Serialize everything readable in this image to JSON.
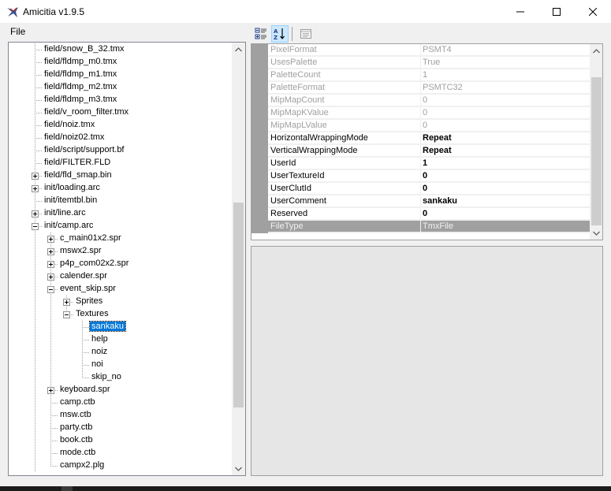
{
  "window": {
    "title": "Amicitia v1.9.5"
  },
  "menu": {
    "file": "File"
  },
  "tree": {
    "items": [
      {
        "label": "field/snow_B_32.tmx",
        "level": 0,
        "expander": "none"
      },
      {
        "label": "field/fldmp_m0.tmx",
        "level": 0,
        "expander": "none"
      },
      {
        "label": "field/fldmp_m1.tmx",
        "level": 0,
        "expander": "none"
      },
      {
        "label": "field/fldmp_m2.tmx",
        "level": 0,
        "expander": "none"
      },
      {
        "label": "field/fldmp_m3.tmx",
        "level": 0,
        "expander": "none"
      },
      {
        "label": "field/v_room_filter.tmx",
        "level": 0,
        "expander": "none"
      },
      {
        "label": "field/noiz.tmx",
        "level": 0,
        "expander": "none"
      },
      {
        "label": "field/noiz02.tmx",
        "level": 0,
        "expander": "none"
      },
      {
        "label": "field/script/support.bf",
        "level": 0,
        "expander": "none"
      },
      {
        "label": "field/FILTER.FLD",
        "level": 0,
        "expander": "none"
      },
      {
        "label": "field/fld_smap.bin",
        "level": 0,
        "expander": "plus"
      },
      {
        "label": "init/loading.arc",
        "level": 0,
        "expander": "plus"
      },
      {
        "label": "init/itemtbl.bin",
        "level": 0,
        "expander": "none"
      },
      {
        "label": "init/line.arc",
        "level": 0,
        "expander": "plus"
      },
      {
        "label": "init/camp.arc",
        "level": 0,
        "expander": "minus"
      },
      {
        "label": "c_main01x2.spr",
        "level": 1,
        "expander": "plus"
      },
      {
        "label": "mswx2.spr",
        "level": 1,
        "expander": "plus"
      },
      {
        "label": "p4p_com02x2.spr",
        "level": 1,
        "expander": "plus"
      },
      {
        "label": "calender.spr",
        "level": 1,
        "expander": "plus"
      },
      {
        "label": "event_skip.spr",
        "level": 1,
        "expander": "minus"
      },
      {
        "label": "Sprites",
        "level": 2,
        "expander": "plus"
      },
      {
        "label": "Textures",
        "level": 2,
        "expander": "minus"
      },
      {
        "label": "sankaku",
        "level": 3,
        "expander": "none",
        "selected": true
      },
      {
        "label": "help",
        "level": 3,
        "expander": "none"
      },
      {
        "label": "noiz",
        "level": 3,
        "expander": "none"
      },
      {
        "label": "noi",
        "level": 3,
        "expander": "none"
      },
      {
        "label": "skip_no",
        "level": 3,
        "expander": "none"
      },
      {
        "label": "keyboard.spr",
        "level": 1,
        "expander": "plus"
      },
      {
        "label": "camp.ctb",
        "level": 1,
        "expander": "none"
      },
      {
        "label": "msw.ctb",
        "level": 1,
        "expander": "none"
      },
      {
        "label": "party.ctb",
        "level": 1,
        "expander": "none"
      },
      {
        "label": "book.ctb",
        "level": 1,
        "expander": "none"
      },
      {
        "label": "mode.ctb",
        "level": 1,
        "expander": "none"
      },
      {
        "label": "campx2.plg",
        "level": 1,
        "expander": "none"
      }
    ]
  },
  "properties": {
    "rows": [
      {
        "name": "PixelFormat",
        "value": "PSMT4",
        "readonly": true
      },
      {
        "name": "UsesPalette",
        "value": "True",
        "readonly": true
      },
      {
        "name": "PaletteCount",
        "value": "1",
        "readonly": true
      },
      {
        "name": "PaletteFormat",
        "value": "PSMTC32",
        "readonly": true
      },
      {
        "name": "MipMapCount",
        "value": "0",
        "readonly": true
      },
      {
        "name": "MipMapKValue",
        "value": "0",
        "readonly": true
      },
      {
        "name": "MipMapLValue",
        "value": "0",
        "readonly": true
      },
      {
        "name": "HorizontalWrappingMode",
        "value": "Repeat",
        "readonly": false
      },
      {
        "name": "VerticalWrappingMode",
        "value": "Repeat",
        "readonly": false
      },
      {
        "name": "UserId",
        "value": "1",
        "readonly": false
      },
      {
        "name": "UserTextureId",
        "value": "0",
        "readonly": false
      },
      {
        "name": "UserClutId",
        "value": "0",
        "readonly": false
      },
      {
        "name": "UserComment",
        "value": "sankaku",
        "readonly": false
      },
      {
        "name": "Reserved",
        "value": "0",
        "readonly": false
      },
      {
        "name": "FileType",
        "value": "TmxFile",
        "readonly": true,
        "last": true
      }
    ]
  },
  "colors": {
    "selection": "#0078d7",
    "grid_margin": "#a0a0a0",
    "readonly_text": "#a0a0a0"
  }
}
